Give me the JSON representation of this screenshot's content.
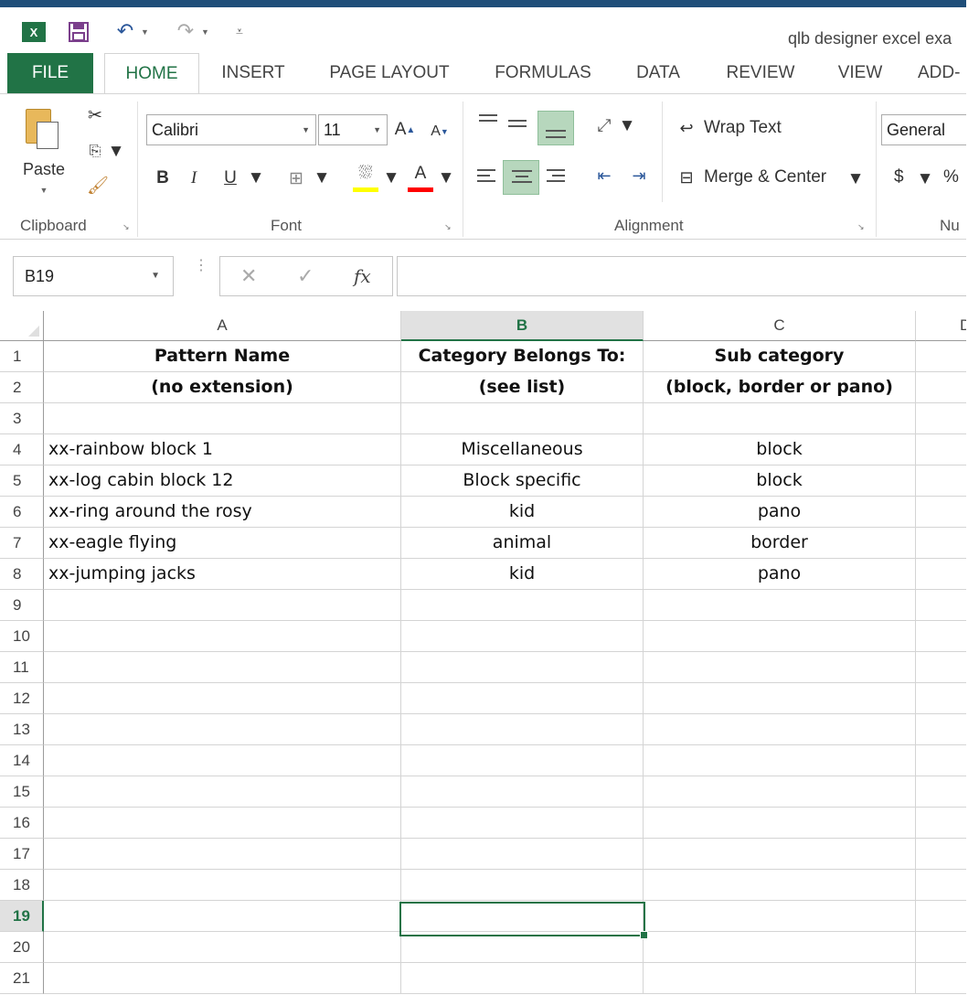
{
  "app": {
    "logo_text": "X",
    "doc_title": "qlb designer excel exa"
  },
  "tabs": [
    "FILE",
    "HOME",
    "INSERT",
    "PAGE LAYOUT",
    "FORMULAS",
    "DATA",
    "REVIEW",
    "VIEW",
    "ADD-"
  ],
  "ribbon": {
    "paste_label": "Paste",
    "font_name": "Calibri",
    "font_size": "11",
    "grow_font": "A",
    "shrink_font": "A",
    "bold": "B",
    "italic": "I",
    "underline": "U",
    "font_color_letter": "A",
    "wrap_text": "Wrap Text",
    "merge_center": "Merge & Center",
    "number_format": "General",
    "currency": "$",
    "percent": "%",
    "groups": {
      "clipboard": "Clipboard",
      "font": "Font",
      "alignment": "Alignment",
      "number": "Nu"
    },
    "colors": {
      "highlight": "#ffff00",
      "font_color": "#ff0000"
    }
  },
  "formula_bar": {
    "name_box": "B19",
    "cancel": "✕",
    "enter": "✓",
    "fx": "fx",
    "content": ""
  },
  "sheet": {
    "columns": [
      "A",
      "B",
      "C",
      "D"
    ],
    "selected_column": "B",
    "selected_row": "19",
    "rows": [
      {
        "num": "1",
        "a": "Pattern Name",
        "b": "Category Belongs To:",
        "c": "Sub category"
      },
      {
        "num": "2",
        "a": "(no extension)",
        "b": "(see list)",
        "c": "(block, border or pano)"
      },
      {
        "num": "3",
        "a": "",
        "b": "",
        "c": ""
      },
      {
        "num": "4",
        "a": "xx-rainbow block 1",
        "b": "Miscellaneous",
        "c": "block"
      },
      {
        "num": "5",
        "a": "xx-log cabin block 12",
        "b": "Block specific",
        "c": "block"
      },
      {
        "num": "6",
        "a": "xx-ring around the rosy",
        "b": "kid",
        "c": "pano"
      },
      {
        "num": "7",
        "a": "xx-eagle flying",
        "b": "animal",
        "c": "border"
      },
      {
        "num": "8",
        "a": "xx-jumping jacks",
        "b": "kid",
        "c": "pano"
      },
      {
        "num": "9",
        "a": "",
        "b": "",
        "c": ""
      },
      {
        "num": "10",
        "a": "",
        "b": "",
        "c": ""
      },
      {
        "num": "11",
        "a": "",
        "b": "",
        "c": ""
      },
      {
        "num": "12",
        "a": "",
        "b": "",
        "c": ""
      },
      {
        "num": "13",
        "a": "",
        "b": "",
        "c": ""
      },
      {
        "num": "14",
        "a": "",
        "b": "",
        "c": ""
      },
      {
        "num": "15",
        "a": "",
        "b": "",
        "c": ""
      },
      {
        "num": "16",
        "a": "",
        "b": "",
        "c": ""
      },
      {
        "num": "17",
        "a": "",
        "b": "",
        "c": ""
      },
      {
        "num": "18",
        "a": "",
        "b": "",
        "c": ""
      },
      {
        "num": "19",
        "a": "",
        "b": "",
        "c": ""
      },
      {
        "num": "20",
        "a": "",
        "b": "",
        "c": ""
      },
      {
        "num": "21",
        "a": "",
        "b": "",
        "c": ""
      }
    ]
  }
}
